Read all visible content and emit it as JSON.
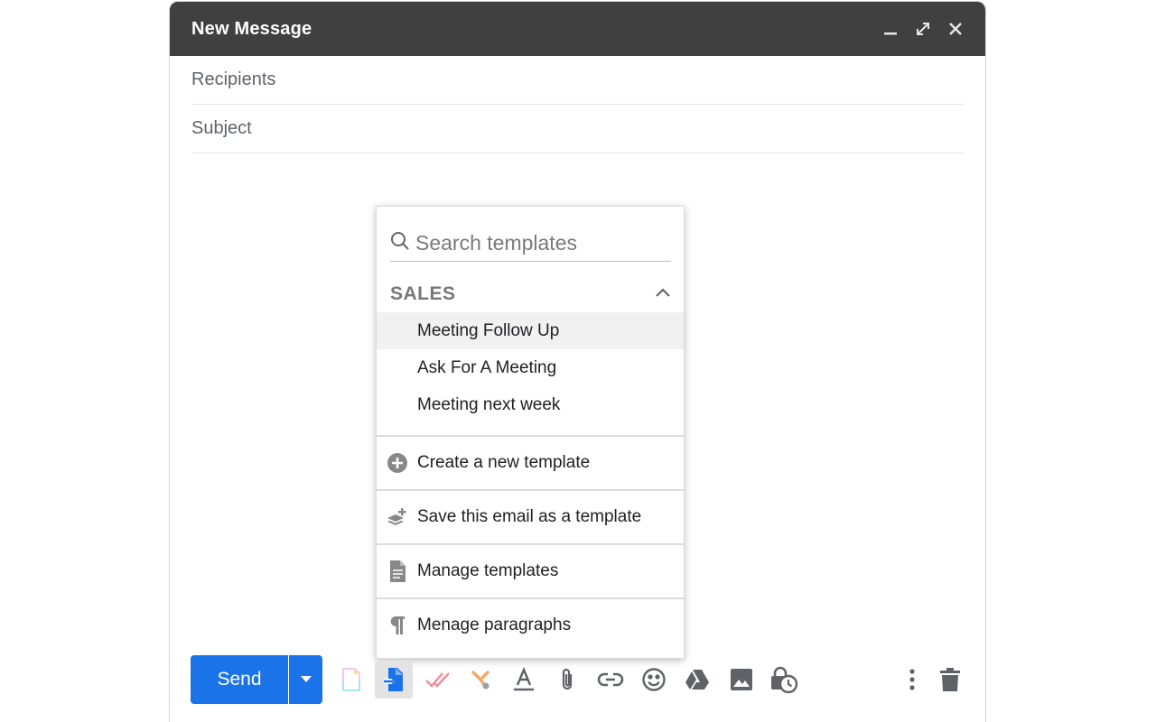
{
  "window": {
    "title": "New Message",
    "controls": {
      "minimize_icon": "minimize-icon",
      "expand_icon": "expand-icon",
      "close_icon": "close-icon"
    }
  },
  "fields": {
    "recipients_placeholder": "Recipients",
    "subject_placeholder": "Subject"
  },
  "template_menu": {
    "search_placeholder": "Search templates",
    "section": "SALES",
    "templates": [
      "Meeting Follow Up",
      "Ask For A Meeting",
      "Meeting next week"
    ],
    "actions": {
      "create": "Create a new template",
      "save": "Save this email as a template",
      "manage": "Manage templates",
      "paragraphs": "Menage paragraphs"
    }
  },
  "toolbar": {
    "send_label": "Send",
    "colors": {
      "send": "#1a73e8",
      "title_bar": "#404040",
      "templates_icon": "#1a73e8"
    }
  }
}
